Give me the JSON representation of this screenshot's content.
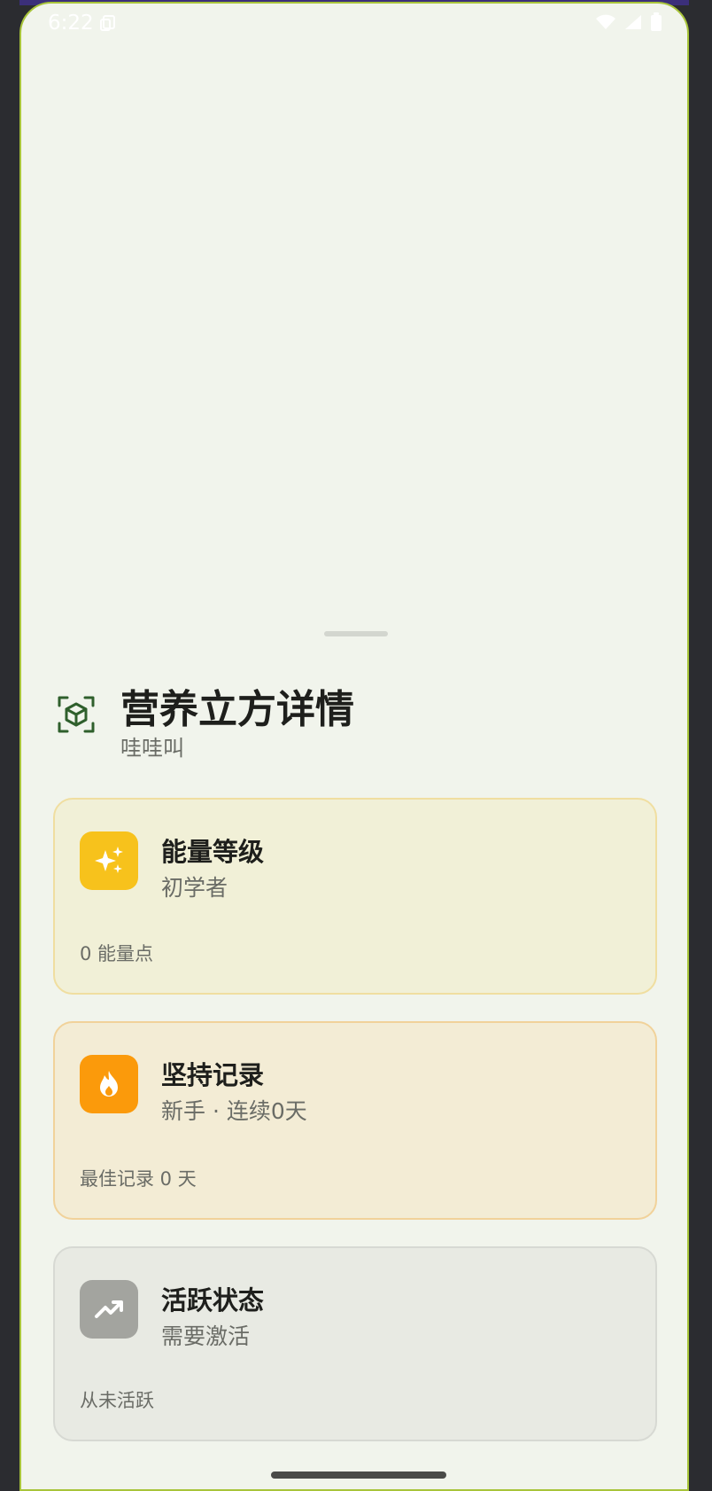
{
  "status_bar": {
    "time": "6:22"
  },
  "header": {
    "title": "营养立方详情",
    "subtitle": "哇哇叫",
    "icon": "cube-scan-icon"
  },
  "cards": [
    {
      "title": "能量等级",
      "subtitle": "初学者",
      "footer": "0 能量点",
      "icon": "sparkles-icon",
      "color": "#f7c21c"
    },
    {
      "title": "坚持记录",
      "subtitle": "新手 · 连续0天",
      "footer": "最佳记录 0 天",
      "icon": "flame-icon",
      "color": "#fb9a0b"
    },
    {
      "title": "活跃状态",
      "subtitle": "需要激活",
      "footer": "从未活跃",
      "icon": "trending-up-icon",
      "color": "#a3a49f"
    }
  ],
  "colors": {
    "background": "#f1f4ec",
    "accent_green": "#2f5f2c"
  }
}
